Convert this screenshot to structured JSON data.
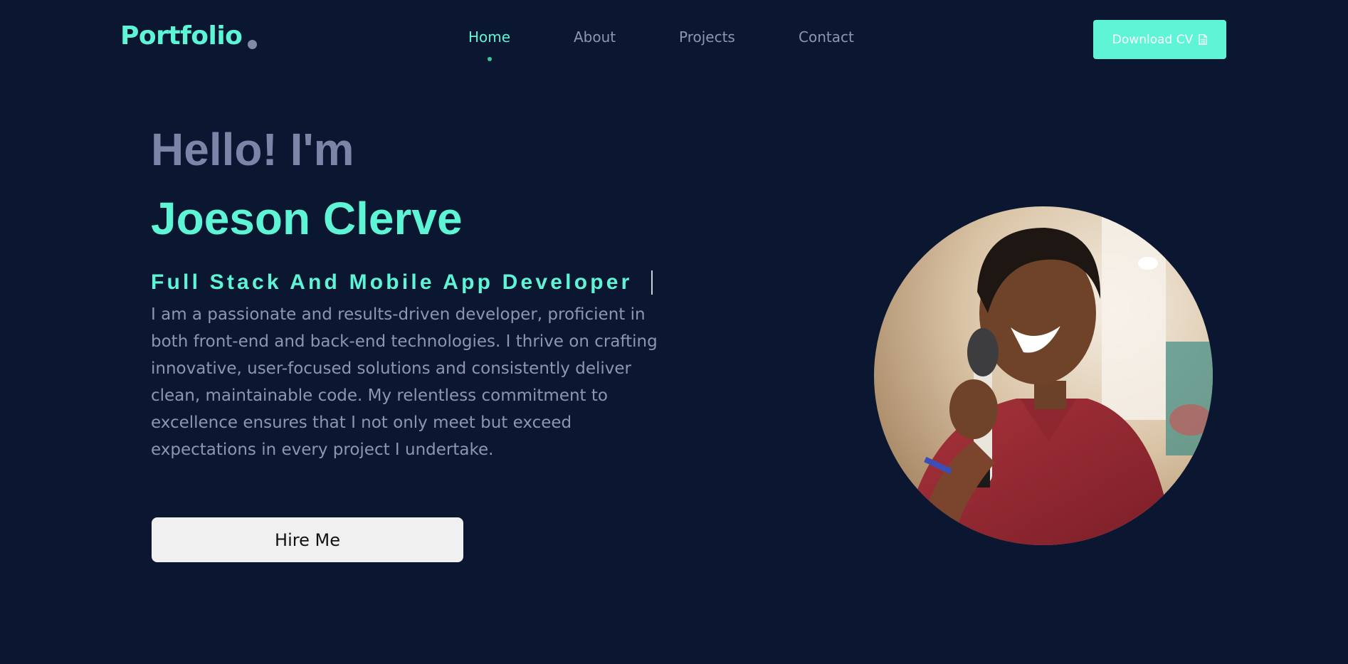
{
  "nav": {
    "logo": "Portfolio",
    "links": [
      {
        "label": "Home",
        "active": true
      },
      {
        "label": "About",
        "active": false
      },
      {
        "label": "Projects",
        "active": false
      },
      {
        "label": "Contact",
        "active": false
      }
    ],
    "download_cv_label": "Download CV",
    "download_icon": "document-icon"
  },
  "hero": {
    "greeting": "Hello! I'm",
    "name": "Joeson Clerve",
    "role": "Full Stack And Mobile App Developer",
    "description": "I am a passionate and results-driven developer, proficient in both front-end and back-end technologies. I thrive on crafting innovative, user-focused solutions and consistently deliver clean, maintainable code. My relentless commitment to excellence ensures that I not only meet but exceed expectations in every project I undertake.",
    "hire_label": "Hire Me"
  },
  "colors": {
    "background": "#0b1730",
    "accent": "#5ef5d6",
    "muted": "#8b96b3",
    "button_light": "#f0f0f0"
  }
}
